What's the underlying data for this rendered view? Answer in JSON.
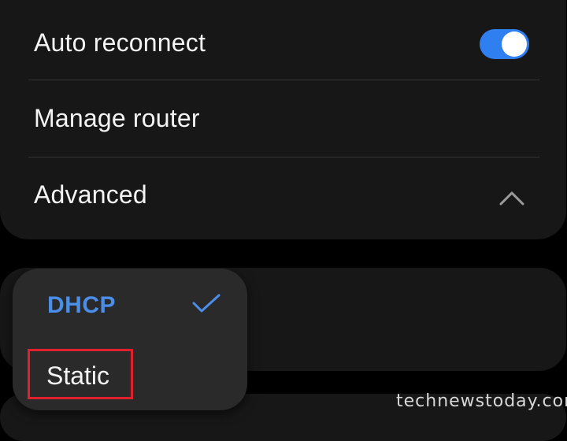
{
  "settings": {
    "auto_reconnect": {
      "label": "Auto reconnect",
      "enabled": true
    },
    "manage_router": {
      "label": "Manage router"
    },
    "advanced": {
      "label": "Advanced",
      "expanded": true
    }
  },
  "ip_settings_menu": {
    "options": [
      {
        "label": "DHCP",
        "selected": true
      },
      {
        "label": "Static",
        "selected": false
      }
    ]
  },
  "colors": {
    "accent": "#2f7ff1",
    "selected_text": "#4a8ee8",
    "highlight_box": "#e0202a"
  },
  "icons": {
    "toggle": "toggle-switch",
    "advanced": "chevron-up-icon",
    "selected": "check-icon"
  },
  "watermark": "technewstoday.com"
}
